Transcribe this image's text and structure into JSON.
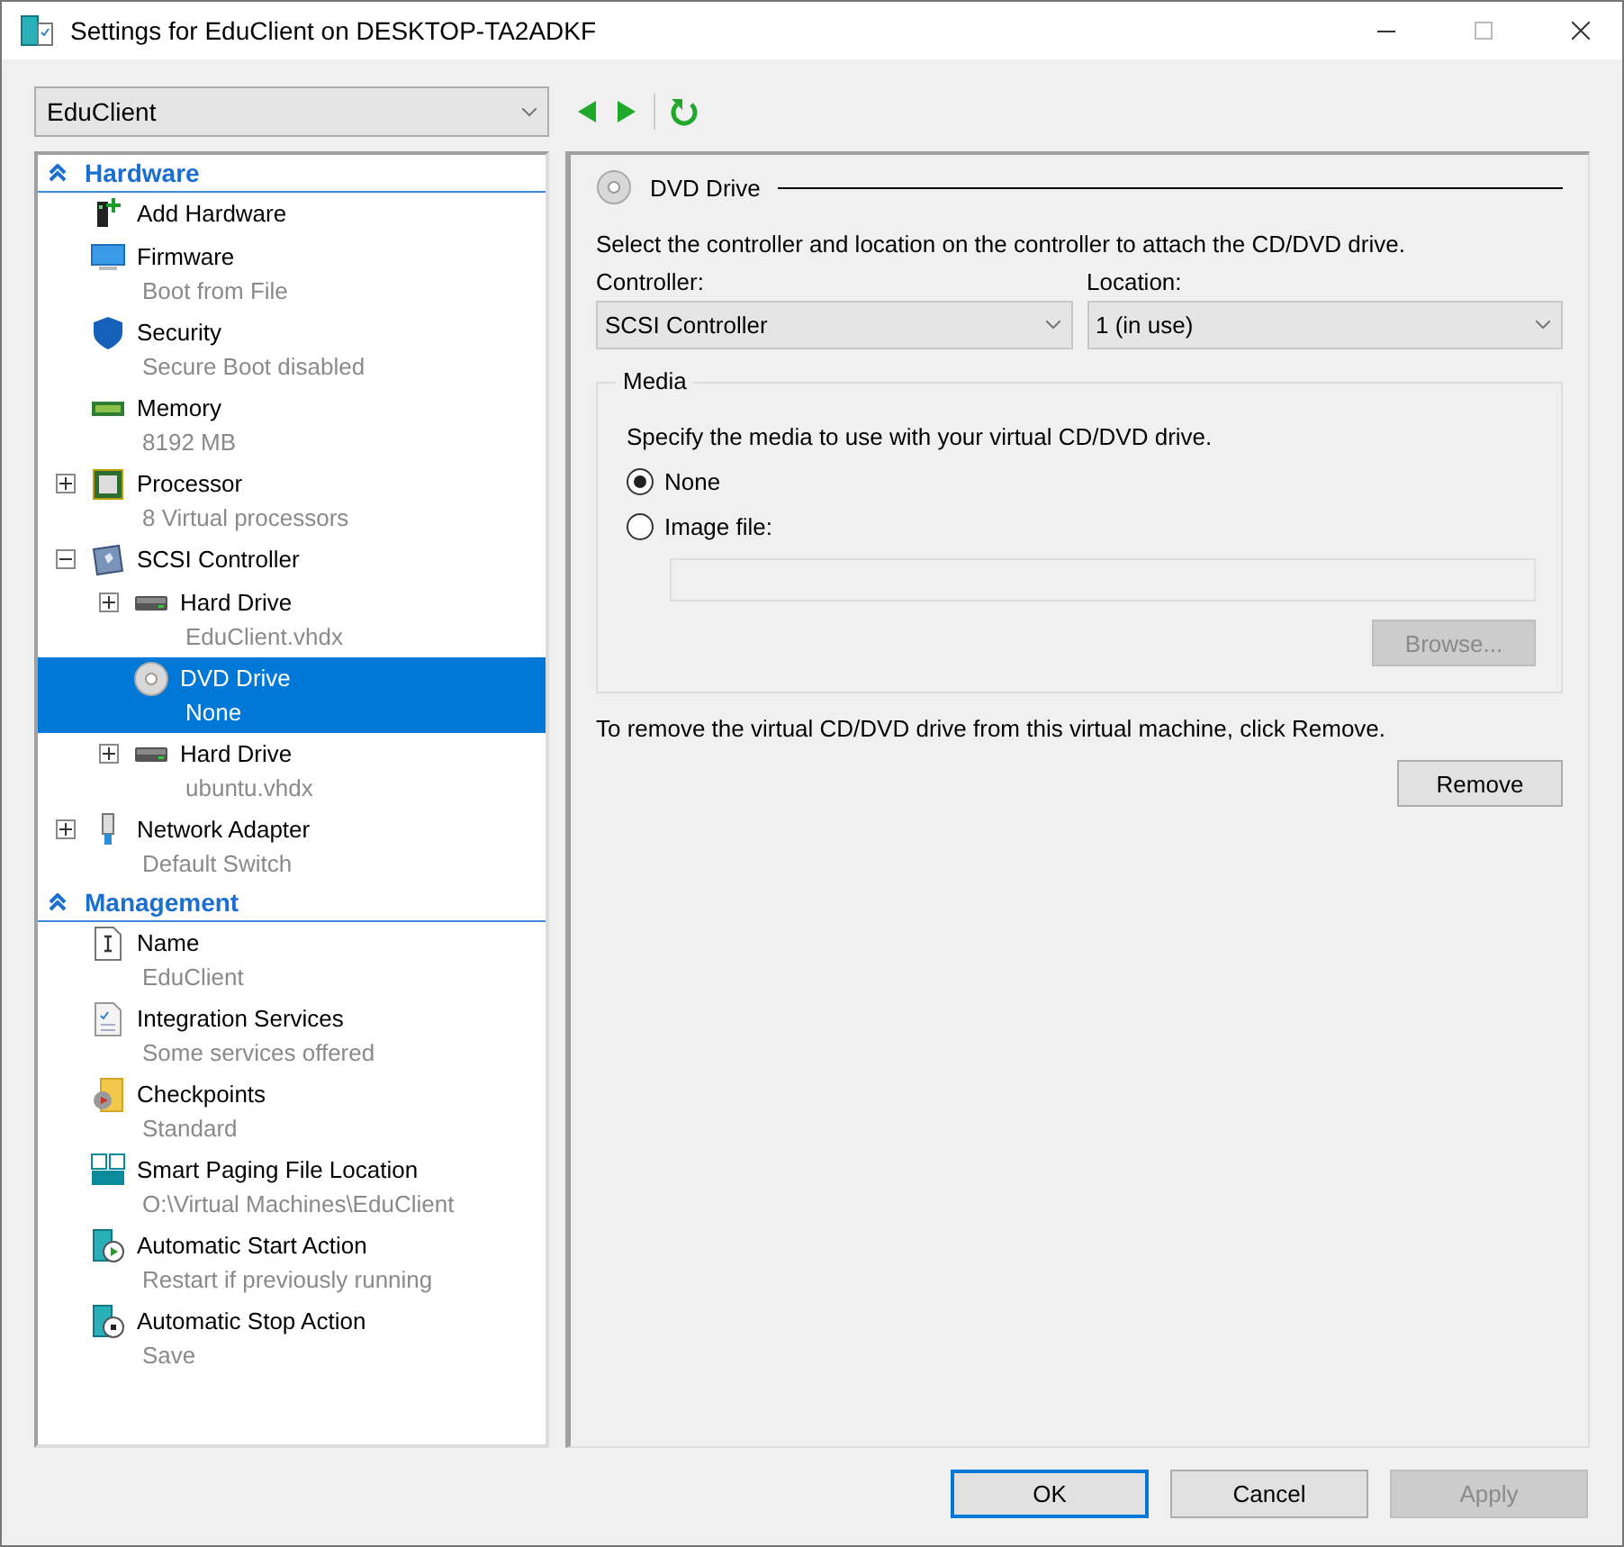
{
  "window": {
    "title": "Settings for EduClient on DESKTOP-TA2ADKF"
  },
  "vm_selector": {
    "value": "EduClient"
  },
  "sidebar": {
    "sections": [
      {
        "title": "Hardware",
        "expanded": true,
        "items": [
          {
            "kind": "add_hardware",
            "label": "Add Hardware",
            "selected": false
          },
          {
            "kind": "firmware",
            "label": "Firmware",
            "detail": "Boot from File",
            "selected": false
          },
          {
            "kind": "security",
            "label": "Security",
            "detail": "Secure Boot disabled",
            "selected": false
          },
          {
            "kind": "memory",
            "label": "Memory",
            "detail": "8192 MB",
            "selected": false
          },
          {
            "kind": "processor",
            "label": "Processor",
            "detail": "8 Virtual processors",
            "expanded": false,
            "selected": false
          },
          {
            "kind": "controller",
            "label": "SCSI Controller",
            "expanded": true,
            "selected": false,
            "children": [
              {
                "kind": "hard_drive",
                "label": "Hard Drive",
                "detail": "EduClient.vhdx",
                "expanded": false,
                "selected": false
              },
              {
                "kind": "dvd",
                "label": "DVD Drive",
                "detail": "None",
                "selected": true
              },
              {
                "kind": "hard_drive",
                "label": "Hard Drive",
                "detail": "ubuntu.vhdx",
                "expanded": false,
                "selected": false
              }
            ]
          },
          {
            "kind": "network",
            "label": "Network Adapter",
            "detail": "Default Switch",
            "expanded": false,
            "selected": false
          }
        ]
      },
      {
        "title": "Management",
        "expanded": true,
        "items": [
          {
            "kind": "name",
            "label": "Name",
            "detail": "EduClient",
            "selected": false
          },
          {
            "kind": "integration",
            "label": "Integration Services",
            "detail": "Some services offered",
            "selected": false
          },
          {
            "kind": "checkpoints",
            "label": "Checkpoints",
            "detail": "Standard",
            "selected": false
          },
          {
            "kind": "paging",
            "label": "Smart Paging File Location",
            "detail": "O:\\Virtual Machines\\EduClient",
            "selected": false
          },
          {
            "kind": "start_action",
            "label": "Automatic Start Action",
            "detail": "Restart if previously running",
            "selected": false
          },
          {
            "kind": "stop_action",
            "label": "Automatic Stop Action",
            "detail": "Save",
            "selected": false
          }
        ]
      }
    ]
  },
  "panel": {
    "title": "DVD Drive",
    "description": "Select the controller and location on the controller to attach the CD/DVD drive.",
    "controller": {
      "label": "Controller:",
      "value": "SCSI Controller"
    },
    "location": {
      "label": "Location:",
      "value": "1 (in use)"
    },
    "media": {
      "title": "Media",
      "description": "Specify the media to use with your virtual CD/DVD drive.",
      "options": [
        {
          "label": "None",
          "selected": true
        },
        {
          "label": "Image file:",
          "selected": false
        }
      ],
      "image_path": {
        "disabled": true
      },
      "browse": {
        "label": "Browse...",
        "disabled": true
      }
    },
    "remove_note": "To remove the virtual CD/DVD drive from this virtual machine, click Remove.",
    "remove": {
      "label": "Remove"
    }
  },
  "buttons": [
    {
      "label": "OK",
      "default": true,
      "disabled": false
    },
    {
      "label": "Cancel",
      "default": false,
      "disabled": false
    },
    {
      "label": "Apply",
      "default": false,
      "disabled": true
    }
  ]
}
